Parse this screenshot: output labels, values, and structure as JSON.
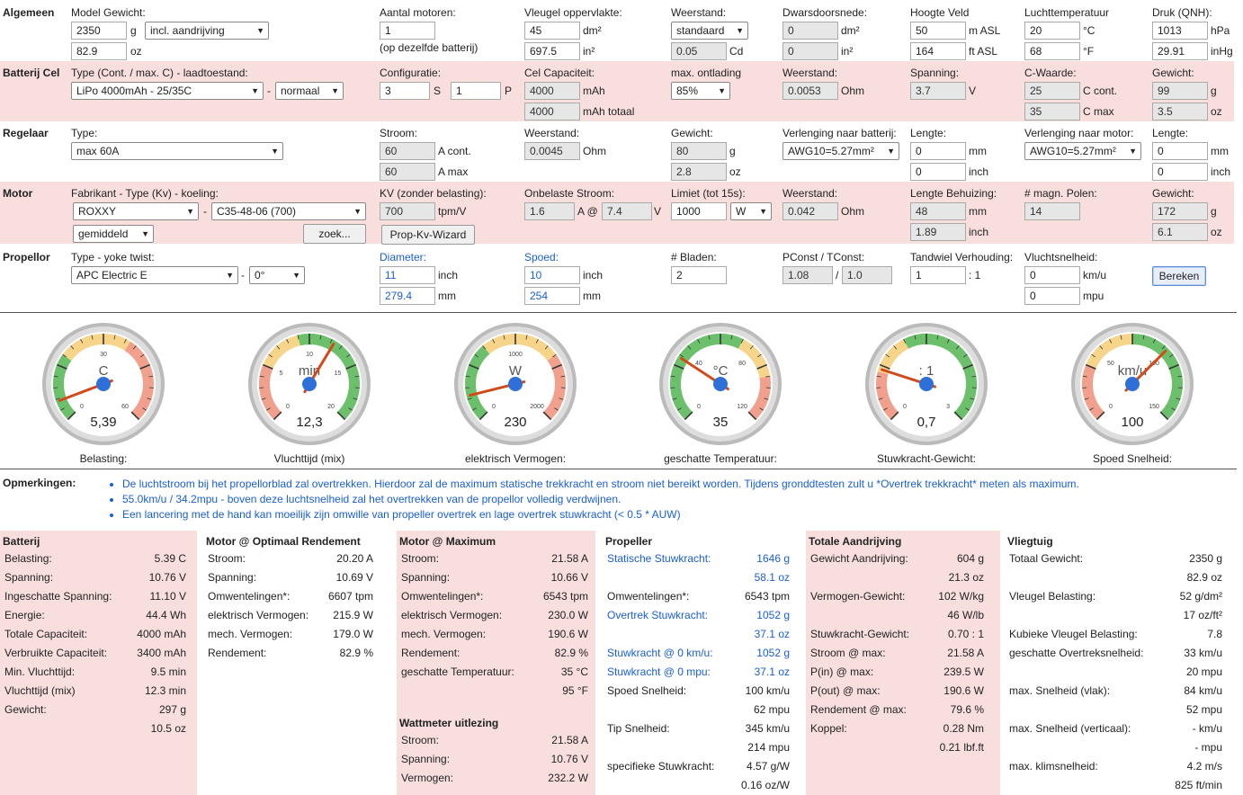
{
  "algemeen": {
    "title": "Algemeen",
    "model_gewicht_label": "Model Gewicht:",
    "gewicht_g": "2350",
    "g": "g",
    "gewicht_oz": "82.9",
    "oz": "oz",
    "gewicht_sel": "incl. aandrijving",
    "motoren_label": "Aantal motoren:",
    "motoren": "1",
    "motoren_note": "(op dezelfde batterij)",
    "vleugel_label": "Vleugel oppervlakte:",
    "vleugel_dm": "45",
    "dm2": "dm²",
    "vleugel_in": "697.5",
    "in2": "in²",
    "weerstand_label": "Weerstand:",
    "weerstand_sel": "standaard",
    "weerstand_cd": "0.05",
    "cd": "Cd",
    "dwars_label": "Dwarsdoorsnede:",
    "dwars_dm": "0",
    "dwars_in": "0",
    "hoogte_label": "Hoogte Veld",
    "hoogte_m": "50",
    "m_asl": "m ASL",
    "hoogte_ft": "164",
    "ft_asl": "ft ASL",
    "temp_label": "Luchttemperatuur",
    "temp_c": "20",
    "c": "°C",
    "temp_f": "68",
    "f": "°F",
    "druk_label": "Druk (QNH):",
    "druk_hpa": "1013",
    "hpa": "hPa",
    "druk_inhg": "29.91",
    "inhg": "inHg"
  },
  "batterij": {
    "title": "Batterij Cel",
    "type_label": "Type (Cont. / max. C) - laadtoestand:",
    "type_sel": "LiPo 4000mAh - 25/35C",
    "dash": "-",
    "laad_sel": "normaal",
    "config_label": "Configuratie:",
    "s_val": "3",
    "s": "S",
    "p_val": "1",
    "p": "P",
    "cap_label": "Cel Capaciteit:",
    "cap": "4000",
    "mah": "mAh",
    "cap_tot": "4000",
    "mah_tot": "mAh totaal",
    "ontlading_label": "max. ontlading",
    "ontlading_sel": "85%",
    "weerstand_label": "Weerstand:",
    "weerstand": "0.0053",
    "ohm": "Ohm",
    "spanning_label": "Spanning:",
    "spanning": "3.7",
    "v": "V",
    "cwaarde_label": "C-Waarde:",
    "c_cont": "25",
    "c_cont_u": "C cont.",
    "c_max": "35",
    "c_max_u": "C max",
    "gewicht_label": "Gewicht:",
    "gewicht_g": "99",
    "g": "g",
    "gewicht_oz": "3.5",
    "oz": "oz"
  },
  "regelaar": {
    "title": "Regelaar",
    "type_label": "Type:",
    "type_sel": "max 60A",
    "stroom_label": "Stroom:",
    "stroom_cont": "60",
    "a_cont": "A cont.",
    "stroom_max": "60",
    "a_max": "A max",
    "weerstand_label": "Weerstand:",
    "weerstand": "0.0045",
    "ohm": "Ohm",
    "gewicht_label": "Gewicht:",
    "gewicht_g": "80",
    "g": "g",
    "gewicht_oz": "2.8",
    "oz": "oz",
    "verl_bat_label": "Verlenging naar batterij:",
    "verl_bat_sel": "AWG10=5.27mm²",
    "lengte_label": "Lengte:",
    "lengte_mm": "0",
    "mm": "mm",
    "lengte_inch": "0",
    "inch": "inch",
    "verl_mot_label": "Verlenging naar motor:",
    "verl_mot_sel": "AWG10=5.27mm²",
    "lengte2_label": "Lengte:",
    "lengte2_mm": "0",
    "lengte2_inch": "0"
  },
  "motor": {
    "title": "Motor",
    "fab_label": "Fabrikant - Type (Kv) - koeling:",
    "fab_sel": "ROXXY",
    "dash": "-",
    "type_sel": "C35-48-06 (700)",
    "koeling_sel": "gemiddeld",
    "zoek": "zoek...",
    "kv_label": "KV (zonder belasting):",
    "kv": "700",
    "tpm_v": "tpm/V",
    "wizard": "Prop-Kv-Wizard",
    "onbelast_label": "Onbelaste Stroom:",
    "onbelast_a": "1.6",
    "a_at": "A @",
    "onbelast_v": "7.4",
    "v": "V",
    "limiet_label": "Limiet (tot 15s):",
    "limiet": "1000",
    "limiet_sel": "W",
    "weerstand_label": "Weerstand:",
    "weerstand": "0.042",
    "ohm": "Ohm",
    "lengte_label": "Lengte Behuizing:",
    "lengte_mm": "48",
    "mm": "mm",
    "lengte_inch": "1.89",
    "inch": "inch",
    "polen_label": "# magn. Polen:",
    "polen": "14",
    "gewicht_label": "Gewicht:",
    "gewicht_g": "172",
    "g": "g",
    "gewicht_oz": "6.1",
    "oz": "oz"
  },
  "propellor": {
    "title": "Propellor",
    "type_label": "Type - yoke twist:",
    "type_sel": "APC Electric E",
    "dash": "-",
    "twist_sel": "0°",
    "diam_label": "Diameter:",
    "diam_inch": "11",
    "inch": "inch",
    "diam_mm": "279.4",
    "mm": "mm",
    "spoed_label": "Spoed:",
    "spoed_inch": "10",
    "spoed_mm": "254",
    "bladen_label": "# Bladen:",
    "bladen": "2",
    "pconst_label": "PConst / TConst:",
    "pconst": "1.08",
    "slash": "/",
    "tconst": "1.0",
    "tandwiel_label": "Tandwiel Verhouding:",
    "tandwiel": "1",
    "ratio": ": 1",
    "vlucht_label": "Vluchtsnelheid:",
    "vlucht_kmu": "0",
    "kmu": "km/u",
    "vlucht_mpu": "0",
    "mpu": "mpu",
    "bereken": "Bereken"
  },
  "gauges": [
    {
      "unit": "C",
      "value": "5,39",
      "label": "Belasting:",
      "t0": "0",
      "t1": "30",
      "t2": "60",
      "fraction": 0.09
    },
    {
      "unit": "min",
      "value": "12,3",
      "label": "Vluchttijd (mix)",
      "t0": "0",
      "t1": "5",
      "t2": "10",
      "t3": "15",
      "t4": "20",
      "fraction": 0.615
    },
    {
      "unit": "W",
      "value": "230",
      "label": "elektrisch Vermogen:",
      "t0": "0",
      "t1": "1000",
      "t2": "2000",
      "fraction": 0.115
    },
    {
      "unit": "°C",
      "value": "35",
      "label": "geschatte Temperatuur:",
      "t0": "0",
      "t1": "40",
      "t2": "80",
      "t3": "120",
      "fraction": 0.29
    },
    {
      "unit": ": 1",
      "value": "0,7",
      "label": "Stuwkracht-Gewicht:",
      "t0": "0",
      "t1": "3",
      "fraction": 0.233
    },
    {
      "unit": "km/u",
      "value": "100",
      "label": "Spoed Snelheid:",
      "t0": "0",
      "t1": "50",
      "t2": "100",
      "t3": "150",
      "fraction": 0.667
    }
  ],
  "opmerkingen": {
    "title": "Opmerkingen:",
    "items": [
      "De luchtstroom bij het propellorblad zal overtrekken. Hierdoor zal de maximum statische trekkracht en stroom niet bereikt worden. Tijdens gronddtesten zult u *Overtrek trekkracht* meten als maximum.",
      "55.0km/u / 34.2mpu - boven deze luchtsnelheid zal het overtrekken van de propellor volledig verdwijnen.",
      "Een lancering met de hand kan moeilijk zijn omwille van propeller overtrek en lage overtrek stuwkracht (< 0.5 * AUW)"
    ]
  },
  "results": {
    "batterij": {
      "title": "Batterij",
      "rows": [
        [
          "Belasting:",
          "5.39 C"
        ],
        [
          "Spanning:",
          "10.76 V"
        ],
        [
          "Ingeschatte Spanning:",
          "11.10 V"
        ],
        [
          "Energie:",
          "44.4 Wh"
        ],
        [
          "Totale Capaciteit:",
          "4000 mAh"
        ],
        [
          "Verbruikte Capaciteit:",
          "3400 mAh"
        ],
        [
          "Min. Vluchttijd:",
          "9.5 min"
        ],
        [
          "Vluchttijd (mix)",
          "12.3 min"
        ],
        [
          "Gewicht:",
          "297 g"
        ],
        [
          "",
          "10.5 oz"
        ]
      ]
    },
    "optimaal": {
      "title": "Motor @ Optimaal Rendement",
      "rows": [
        [
          "Stroom:",
          "20.20 A"
        ],
        [
          "Spanning:",
          "10.69 V"
        ],
        [
          "Omwentelingen*:",
          "6607 tpm"
        ],
        [
          "elektrisch Vermogen:",
          "215.9 W"
        ],
        [
          "mech. Vermogen:",
          "179.0 W"
        ],
        [
          "Rendement:",
          "82.9 %"
        ]
      ]
    },
    "maximum": {
      "title": "Motor @ Maximum",
      "rows": [
        [
          "Stroom:",
          "21.58 A"
        ],
        [
          "Spanning:",
          "10.66 V"
        ],
        [
          "Omwentelingen*:",
          "6543 tpm"
        ],
        [
          "elektrisch Vermogen:",
          "230.0 W"
        ],
        [
          "mech. Vermogen:",
          "190.6 W"
        ],
        [
          "Rendement:",
          "82.9 %"
        ],
        [
          "geschatte Temperatuur:",
          "35 °C"
        ],
        [
          "",
          "95 °F"
        ]
      ],
      "watt_title": "Wattmeter uitlezing",
      "watt_rows": [
        [
          "Stroom:",
          "21.58 A"
        ],
        [
          "Spanning:",
          "10.76 V"
        ],
        [
          "Vermogen:",
          "232.2 W"
        ]
      ]
    },
    "propeller": {
      "title": "Propeller",
      "rows": [
        [
          "Statische Stuwkracht:",
          "1646 g",
          true
        ],
        [
          "",
          "58.1 oz",
          true
        ],
        [
          "Omwentelingen*:",
          "6543 tpm",
          false
        ],
        [
          "Overtrek Stuwkracht:",
          "1052 g",
          true
        ],
        [
          "",
          "37.1 oz",
          true
        ],
        [
          "Stuwkracht @ 0 km/u:",
          "1052 g",
          true
        ],
        [
          "Stuwkracht @ 0 mpu:",
          "37.1 oz",
          true
        ],
        [
          "Spoed Snelheid:",
          "100 km/u",
          false
        ],
        [
          "",
          "62 mpu",
          false
        ],
        [
          "Tip Snelheid:",
          "345 km/u",
          false
        ],
        [
          "",
          "214 mpu",
          false
        ],
        [
          "specifieke Stuwkracht:",
          "4.57 g/W",
          false
        ],
        [
          "",
          "0.16 oz/W",
          false
        ]
      ]
    },
    "aandrijving": {
      "title": "Totale Aandrijving",
      "rows": [
        [
          "Gewicht Aandrijving:",
          "604 g"
        ],
        [
          "",
          "21.3 oz"
        ],
        [
          "Vermogen-Gewicht:",
          "102 W/kg"
        ],
        [
          "",
          "46 W/lb"
        ],
        [
          "Stuwkracht-Gewicht:",
          "0.70 : 1"
        ],
        [
          "Stroom @ max:",
          "21.58 A"
        ],
        [
          "P(in) @ max:",
          "239.5 W"
        ],
        [
          "P(out) @ max:",
          "190.6 W"
        ],
        [
          "Rendement @ max:",
          "79.6 %"
        ],
        [
          "Koppel:",
          "0.28 Nm"
        ],
        [
          "",
          "0.21 lbf.ft"
        ]
      ]
    },
    "vliegtuig": {
      "title": "Vliegtuig",
      "rows": [
        [
          "Totaal Gewicht:",
          "2350 g"
        ],
        [
          "",
          "82.9 oz"
        ],
        [
          "Vleugel Belasting:",
          "52 g/dm²"
        ],
        [
          "",
          "17 oz/ft²"
        ],
        [
          "Kubieke Vleugel Belasting:",
          "7.8"
        ],
        [
          "geschatte Overtreksnelheid:",
          "33 km/u"
        ],
        [
          "",
          "20 mpu"
        ],
        [
          "max. Snelheid (vlak):",
          "84 km/u"
        ],
        [
          "",
          "52 mpu"
        ],
        [
          "max. Snelheid (verticaal):",
          "- km/u"
        ],
        [
          "",
          "- mpu"
        ],
        [
          "max. klimsnelheid:",
          "4.2 m/s"
        ],
        [
          "",
          "825 ft/min"
        ]
      ]
    }
  },
  "colors": {
    "pink": "#f9dede",
    "blue": "#1a5fd0",
    "needle": "#d04a1a",
    "hub": "#2f6fd8",
    "green": "#6cc06c",
    "yellow": "#f6d58a",
    "red": "#f0a08c"
  }
}
